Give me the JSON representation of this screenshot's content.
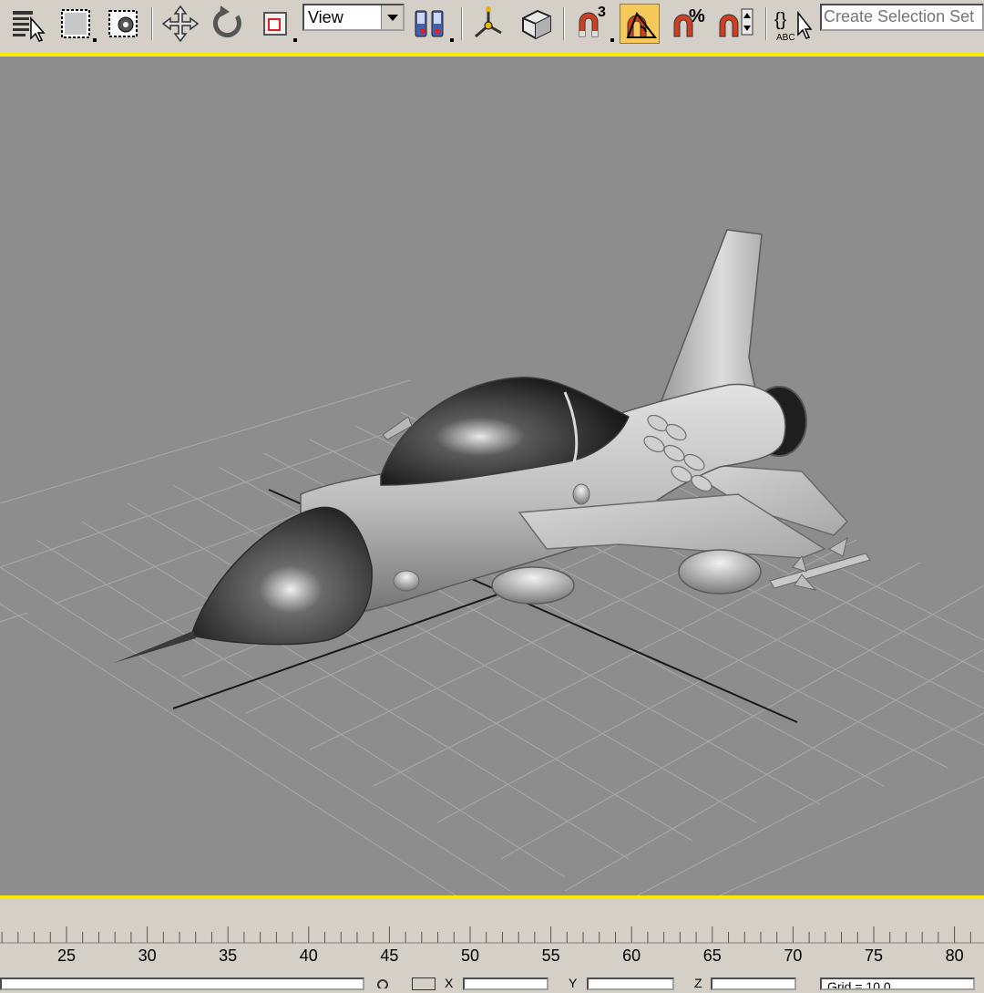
{
  "toolbar": {
    "reference_coord_value": "View",
    "selection_set_placeholder": "Create Selection Set",
    "active_color": "#f7c85a",
    "icons": [
      "select-by-name-icon",
      "rectangle-select-icon",
      "window-crossing-icon",
      "move-icon",
      "rotate-icon",
      "scale-icon",
      "reference-coord-dropdown",
      "pivot-center-icon",
      "axis-constraint-icon",
      "manipulate-icon",
      "snap-3d-icon",
      "angle-snap-icon",
      "percent-snap-icon",
      "spinner-snap-icon",
      "named-selection-icon"
    ]
  },
  "snap": {
    "dimension_label": "3",
    "percent_label": "%",
    "abc_label": "ABC",
    "braces_label": "{}"
  },
  "viewport": {
    "border_color": "#ffe800",
    "background": "#8d8d8d",
    "object": "jet-fighter-model"
  },
  "timeline": {
    "ticks": [
      "25",
      "30",
      "35",
      "40",
      "45",
      "50",
      "55",
      "60",
      "65",
      "70",
      "75",
      "80"
    ]
  },
  "statusbar": {
    "x_label": "X",
    "y_label": "Y",
    "z_label": "Z",
    "grid_text": "Grid = 10.0"
  }
}
